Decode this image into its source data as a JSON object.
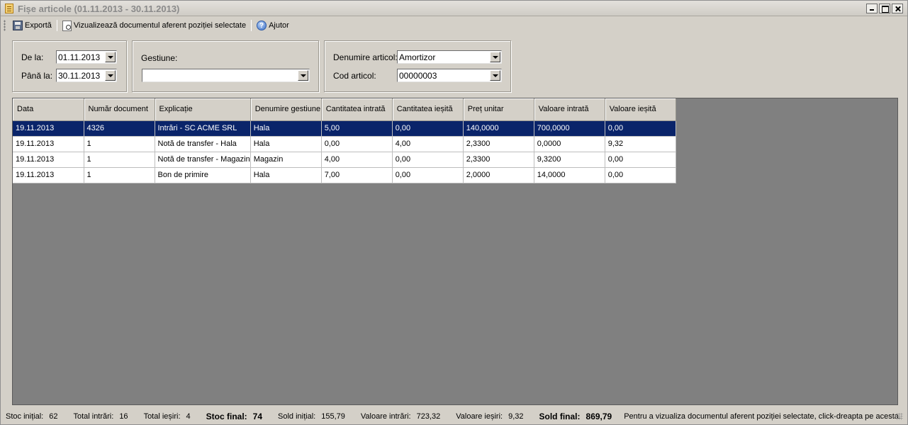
{
  "window": {
    "title": "Fișe articole (01.11.2013 - 30.11.2013)"
  },
  "toolbar": {
    "export_label": "Exportă",
    "view_doc_label": "Vizualizează documentul aferent poziției selectate",
    "help_label": "Ajutor"
  },
  "filters": {
    "from_label": "De la:",
    "from_value": "01.11.2013",
    "to_label": "Până la:",
    "to_value": "30.11.2013",
    "gestiune_label": "Gestiune:",
    "gestiune_value": "",
    "denumire_label": "Denumire articol:",
    "denumire_value": "Amortizor",
    "cod_label": "Cod articol:",
    "cod_value": "00000003"
  },
  "grid": {
    "columns": [
      "Data",
      "Număr document",
      "Explicație",
      "Denumire gestiune",
      "Cantitatea intrată",
      "Cantitatea ieșită",
      "Preț unitar",
      "Valoare intrată",
      "Valoare ieșită"
    ],
    "rows": [
      [
        "19.11.2013",
        "4326",
        "Intrări - SC ACME SRL",
        "Hala",
        "5,00",
        "0,00",
        "140,0000",
        "700,0000",
        "0,00"
      ],
      [
        "19.11.2013",
        "1",
        "Notă de transfer - Hala",
        "Hala",
        "0,00",
        "4,00",
        "2,3300",
        "0,0000",
        "9,32"
      ],
      [
        "19.11.2013",
        "1",
        "Notă de transfer - Magazin",
        "Magazin",
        "4,00",
        "0,00",
        "2,3300",
        "9,3200",
        "0,00"
      ],
      [
        "19.11.2013",
        "1",
        "Bon de primire",
        "Hala",
        "7,00",
        "0,00",
        "2,0000",
        "14,0000",
        "0,00"
      ]
    ],
    "selected_row": 0
  },
  "status": {
    "stoc_initial_label": "Stoc inițial:",
    "stoc_initial": "62",
    "total_intrari_label": "Total intrări:",
    "total_intrari": "16",
    "total_iesiri_label": "Total ieșiri:",
    "total_iesiri": "4",
    "stoc_final_label": "Stoc final:",
    "stoc_final": "74",
    "sold_initial_label": "Sold inițial:",
    "sold_initial": "155,79",
    "valoare_intrari_label": "Valoare intrări:",
    "valoare_intrari": "723,32",
    "valoare_iesiri_label": "Valoare ieșiri:",
    "valoare_iesiri": "9,32",
    "sold_final_label": "Sold final:",
    "sold_final": "869,79",
    "hint": "Pentru a vizualiza documentul aferent poziției selectate, click-dreapta pe acesta."
  }
}
